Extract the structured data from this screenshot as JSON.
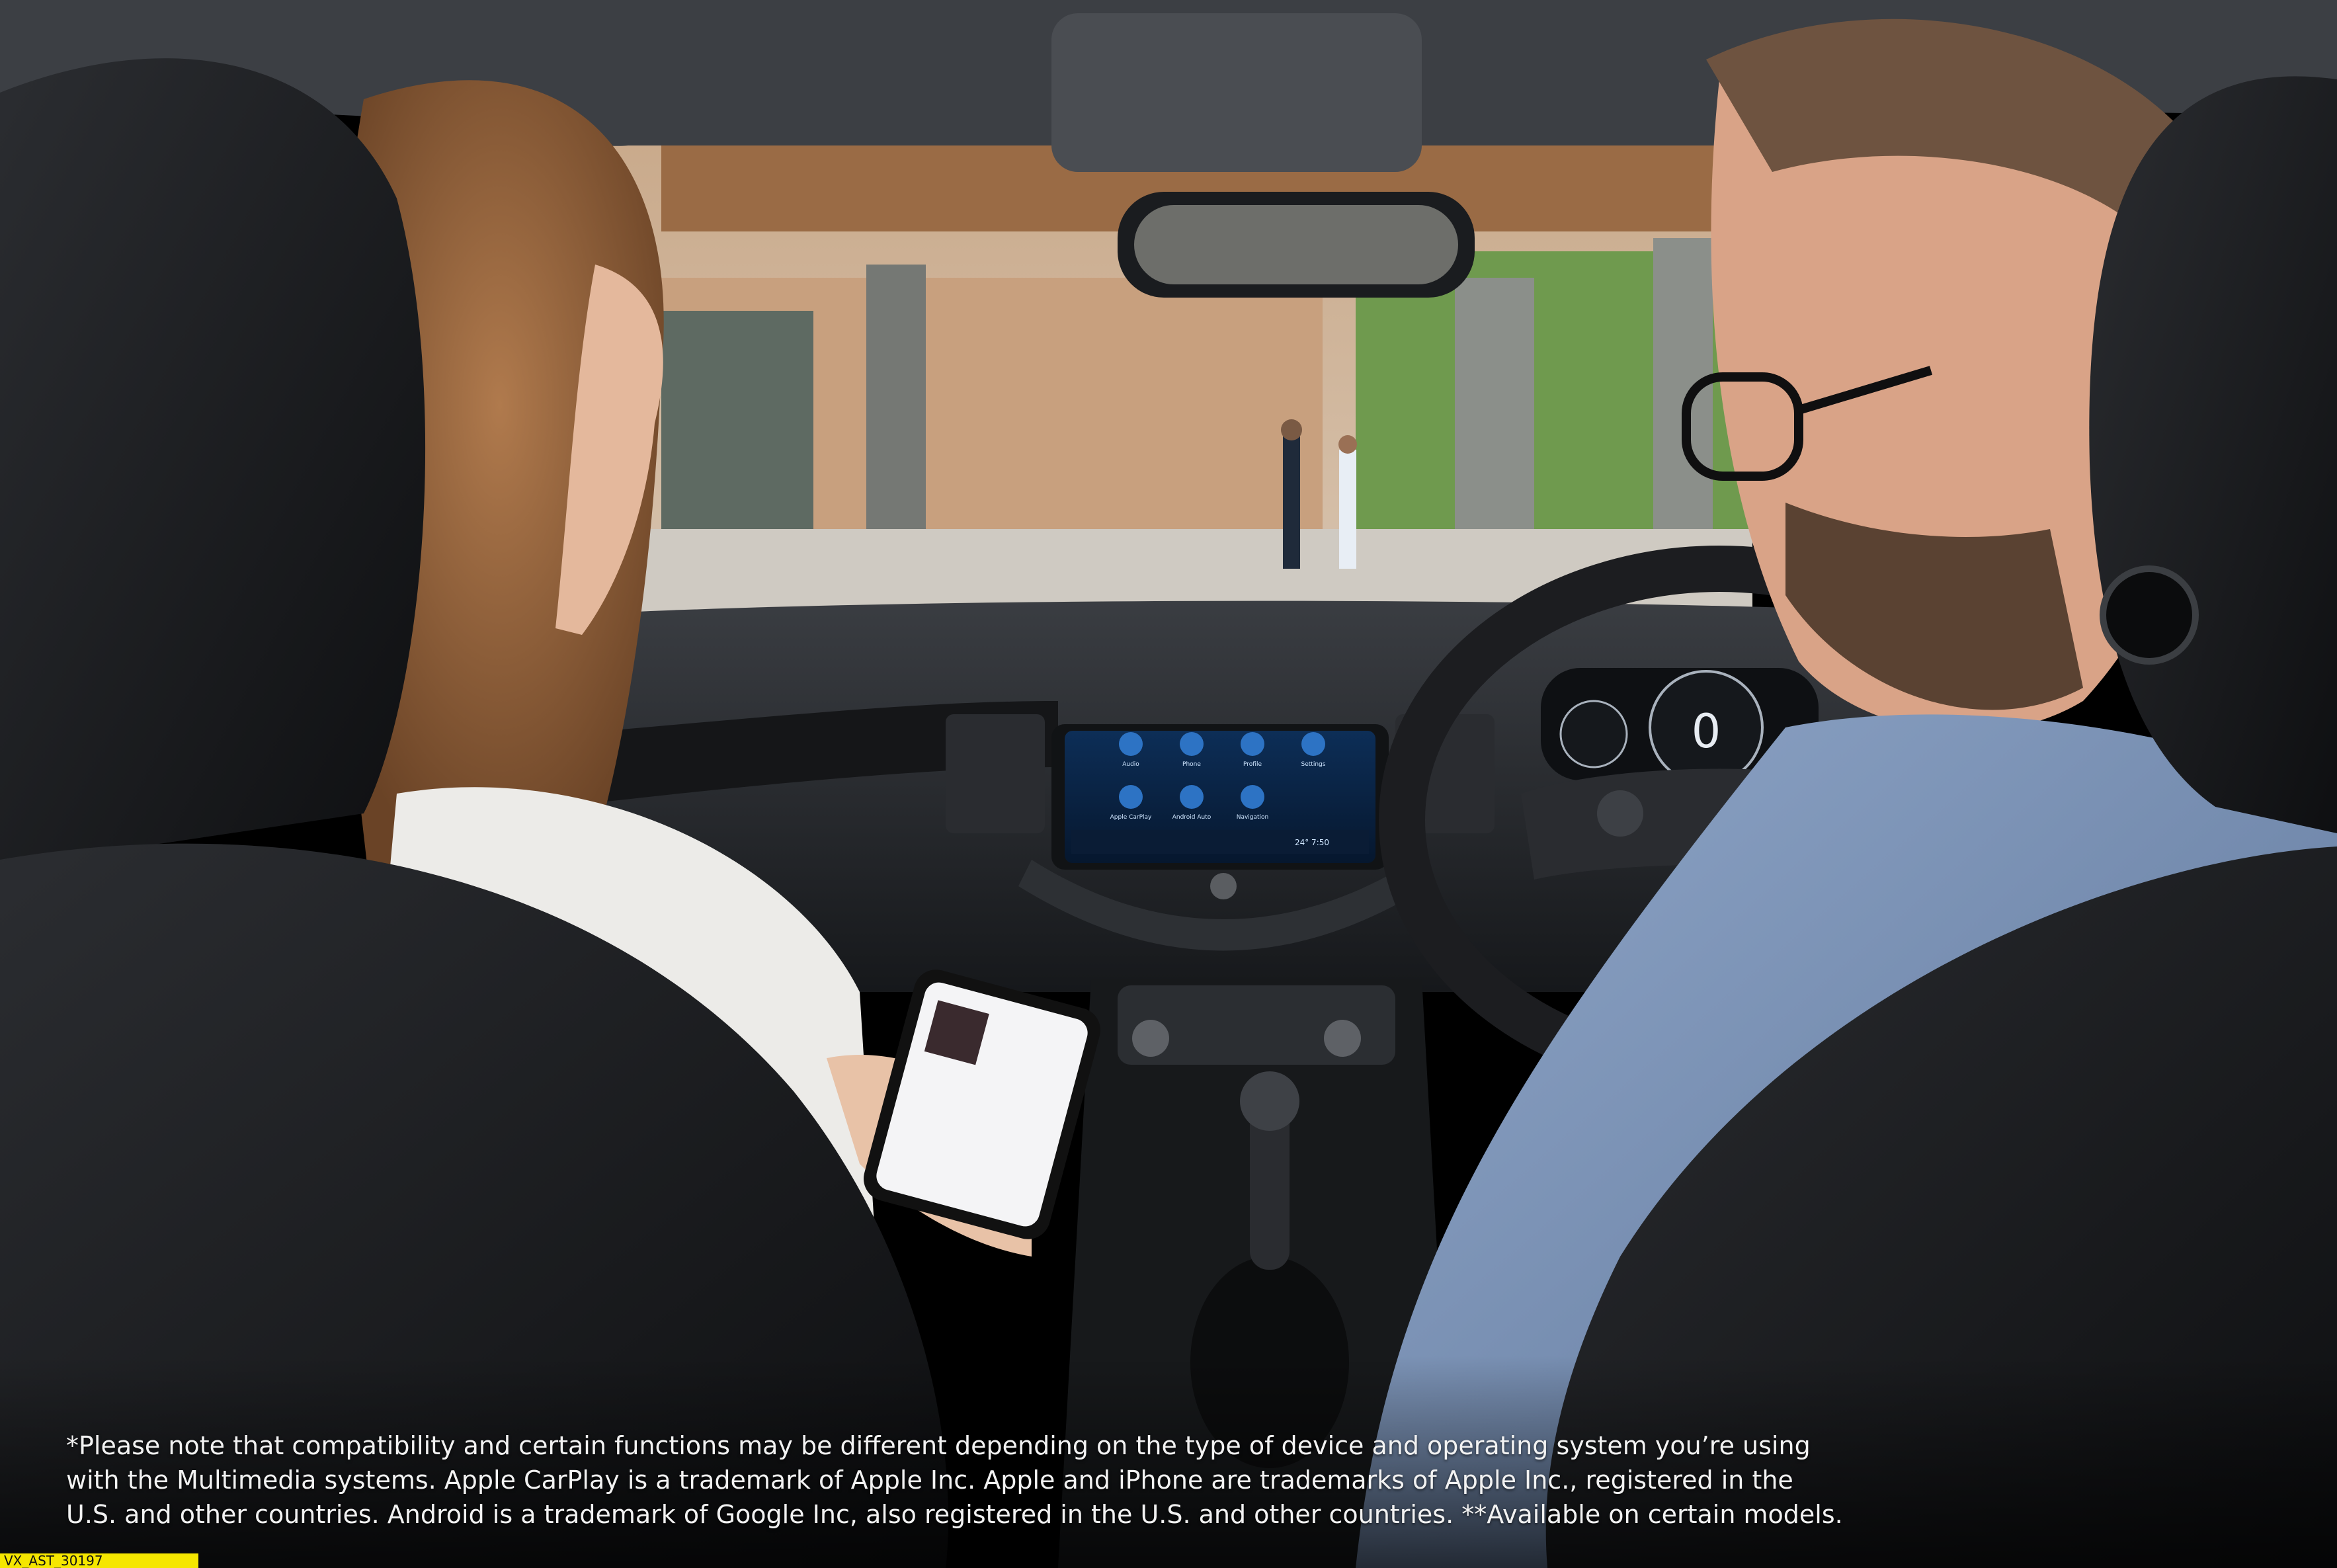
{
  "disclaimer": {
    "line1": "*Please note that compatibility and certain functions may be different depending on the type of device and operating system you’re using",
    "line2": "with the Multimedia systems. Apple CarPlay is a trademark of Apple Inc. Apple and iPhone are trademarks of Apple Inc., registered in the",
    "line3": "U.S. and other countries. Android is a trademark of Google Inc, also registered in the U.S. and other countries. **Available on certain models."
  },
  "code_tag": "VX_AST_30197",
  "infotainment": {
    "apps": [
      "Audio",
      "Phone",
      "Profile",
      "Settings",
      "Apple CarPlay",
      "Android Auto",
      "Navigation"
    ],
    "status": "24° 7:50"
  },
  "cluster": {
    "speed": "0"
  },
  "colors": {
    "tag_yellow": "#f5e600",
    "screen_blue": "#2d73c4",
    "interior": "#1b1d20"
  }
}
